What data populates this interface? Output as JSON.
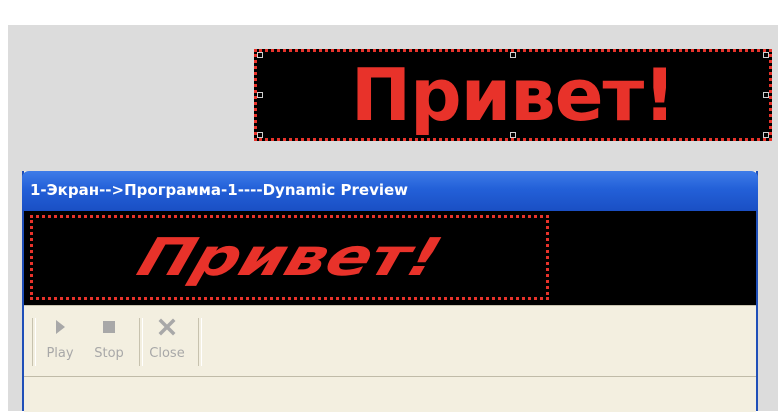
{
  "editor": {
    "text": "Привет!",
    "text_color": "#e8322a"
  },
  "window": {
    "title": "1-Экран-->Программа-1----Dynamic Preview",
    "preview_text": "Привет!",
    "titlebar_color": "#2360d8"
  },
  "toolbar": {
    "play_label": "Play",
    "stop_label": "Stop",
    "close_label": "Close"
  }
}
